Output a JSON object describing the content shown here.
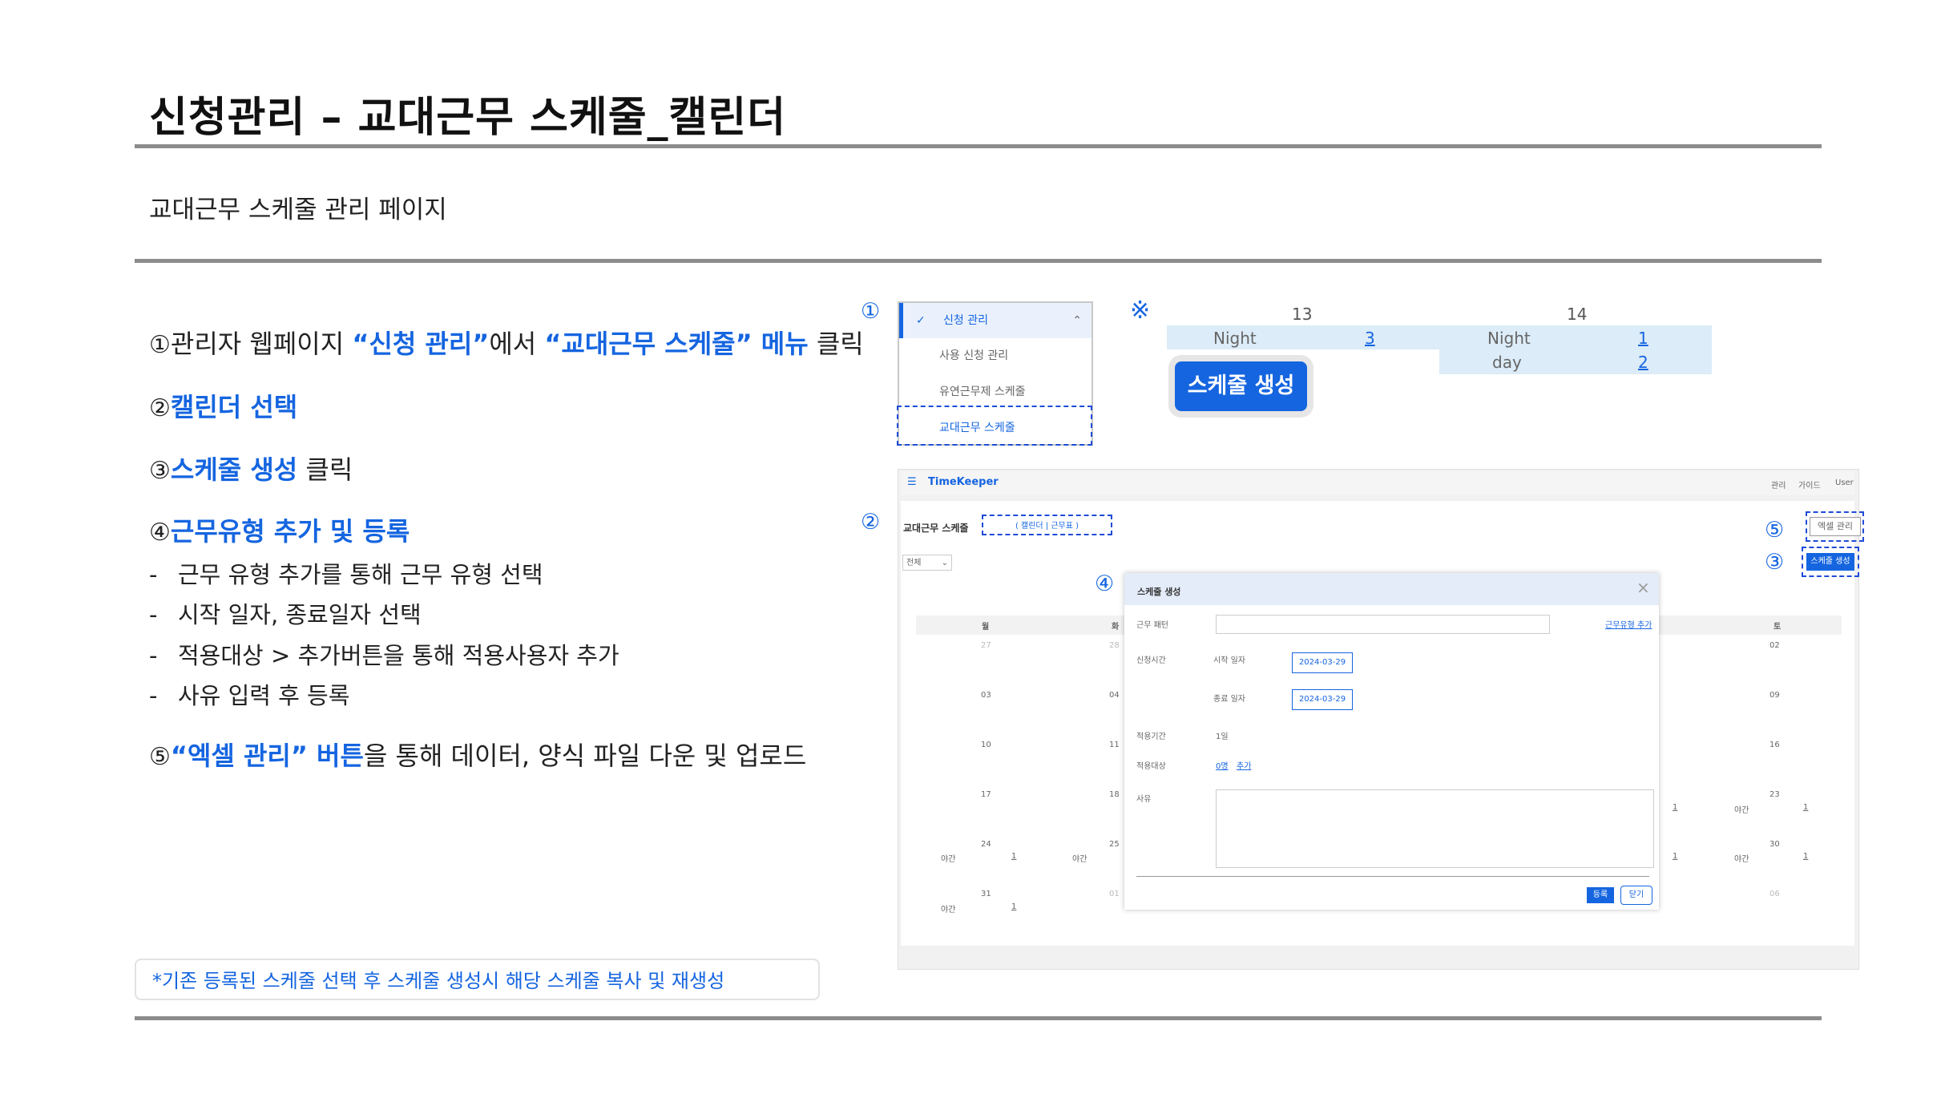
{
  "page": {
    "title": "신청관리 – 교대근무 스케줄_캘린더",
    "subtitle": "교대근무 스케줄 관리 페이지"
  },
  "steps": [
    {
      "num": "①",
      "pre": "관리자 웹페이지 ",
      "b1": "“신청 관리”",
      "mid": "에서 ",
      "b2": "“교대근무 스케줄” 메뉴",
      "post": " 클릭"
    },
    {
      "num": "②",
      "b1": "캘린더 선택"
    },
    {
      "num": "③",
      "b1": "스케줄 생성",
      "post": " 클릭"
    },
    {
      "num": "④",
      "b1": "근무유형 추가 및 등록"
    },
    {
      "num": "⑤",
      "b1": "“엑셀 관리” 버튼",
      "post": "을 통해 데이터, 양식 파일 다운 및 업로드"
    }
  ],
  "substeps": [
    "근무 유형 추가를 통해 근무 유형 선택",
    "시작 일자, 종료일자 선택",
    "적용대상  > 추가버튼을 통해 적용사용자 추가",
    "사유 입력 후 등록"
  ],
  "dash": "-",
  "note": "*기존 등록된 스케줄 선택 후 스케줄 생성시  해당 스케줄 복사 및 재생성",
  "markers": {
    "m1": "①",
    "m2": "②",
    "m3": "③",
    "m4": "④",
    "m5": "⑤",
    "ref": "※"
  },
  "menu": {
    "head": "신청 관리",
    "items": [
      "사용 신청 관리",
      "유연근무제 스케줄",
      "교대근무 스케줄"
    ]
  },
  "example": {
    "day13": "13",
    "day14": "14",
    "night": "Night",
    "night_day": [
      "Night",
      "day"
    ],
    "v13": "3",
    "v14a": "1",
    "v14b": "2",
    "create_btn": "스케줄 생성"
  },
  "app": {
    "logo": "TimeKeeper",
    "top_right": [
      "관리",
      "가이드",
      "User"
    ],
    "page_label": "교대근무 스케줄",
    "toggle": "(   캘린더  |  근무표    )",
    "filter": "전체",
    "excel_btn": "엑셀 관리",
    "create_btn": "스케줄 생성",
    "weekdays": {
      "first": "월",
      "second": "화",
      "last": "토"
    },
    "cal_nums_left": [
      "27",
      "03",
      "10",
      "17",
      "24",
      "31"
    ],
    "cal_nums_mid": [
      "28",
      "04",
      "11",
      "18",
      "25",
      "01"
    ],
    "cal_nums_right": [
      "02",
      "09",
      "16",
      "23",
      "30",
      "06"
    ],
    "cal_night": "야간",
    "cal_one": "1",
    "modal": {
      "title": "스케줄 생성",
      "close": "×",
      "type_label": "근무 패턴",
      "type_add": "근무유형 추가",
      "period_label": "신청시간",
      "start_label": "시작 일자",
      "start_value": "2024-03-29",
      "end_label": "종료 일자",
      "end_value": "2024-03-29",
      "duration_label": "적용기간",
      "duration_value": "1일",
      "target_label": "적용대상",
      "target_count": "0명",
      "target_add": "추가",
      "reason_label": "사유",
      "register": "등록",
      "cancel": "닫기"
    }
  }
}
